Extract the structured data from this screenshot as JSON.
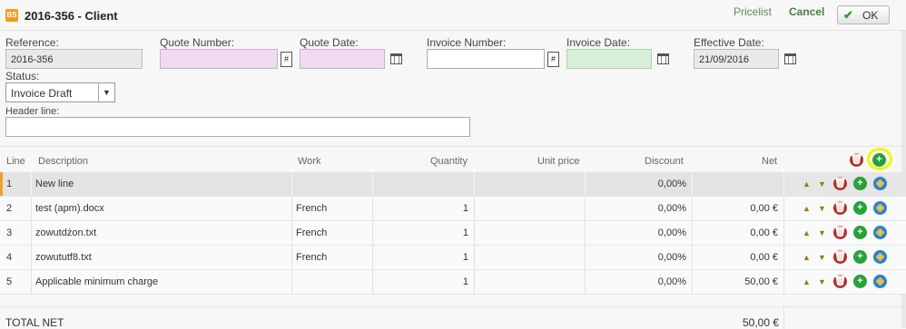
{
  "window": {
    "title": "2016-356 - Client",
    "icon": "document-icon",
    "icon_text": "BS"
  },
  "toolbar": {
    "pricelist_label": "Pricelist",
    "cancel_label": "Cancel",
    "ok_label": "OK",
    "ok_check": "✔"
  },
  "form": {
    "reference": {
      "label": "Reference:",
      "value": "2016-356"
    },
    "quote_number": {
      "label": "Quote Number:",
      "value": "",
      "button": "#"
    },
    "quote_date": {
      "label": "Quote Date:",
      "value": ""
    },
    "invoice_number": {
      "label": "Invoice Number:",
      "value": "",
      "button": "#"
    },
    "invoice_date": {
      "label": "Invoice Date:",
      "value": ""
    },
    "effective_date": {
      "label": "Effective Date:",
      "value": "21/09/2016"
    },
    "status": {
      "label": "Status:",
      "value": "Invoice Draft",
      "arrow": "▼"
    },
    "header_line": {
      "label": "Header line:",
      "value": ""
    }
  },
  "grid": {
    "headers": {
      "line": "Line",
      "description": "Description",
      "work": "Work",
      "quantity": "Quantity",
      "unit_price": "Unit price",
      "discount": "Discount",
      "net": "Net"
    },
    "rows": [
      {
        "line": "1",
        "description": "New line",
        "work": "",
        "quantity": "",
        "unit_price": "",
        "discount": "0,00%",
        "net": ""
      },
      {
        "line": "2",
        "description": "test (apm).docx",
        "work": "French",
        "quantity": "1",
        "unit_price": "",
        "discount": "0,00%",
        "net": "0,00 €"
      },
      {
        "line": "3",
        "description": "zowutdżon.txt",
        "work": "French",
        "quantity": "1",
        "unit_price": "",
        "discount": "0,00%",
        "net": "0,00 €"
      },
      {
        "line": "4",
        "description": "zowututf8.txt",
        "work": "French",
        "quantity": "1",
        "unit_price": "",
        "discount": "0,00%",
        "net": "0,00 €"
      },
      {
        "line": "5",
        "description": "Applicable minimum charge",
        "work": "",
        "quantity": "1",
        "unit_price": "",
        "discount": "0,00%",
        "net": "50,00 €"
      }
    ],
    "action_glyphs": {
      "up": "▲",
      "down": "▼",
      "delete": "🗑",
      "add": "+"
    }
  },
  "totals": {
    "label": "TOTAL NET",
    "value": "50,00 €"
  },
  "colors": {
    "accent_orange": "#f39a1d",
    "link_green": "#4a7c4a",
    "pink_field": "#f2d9f2",
    "green_field": "#d8f0d8",
    "highlight_ring": "#f5f500"
  }
}
